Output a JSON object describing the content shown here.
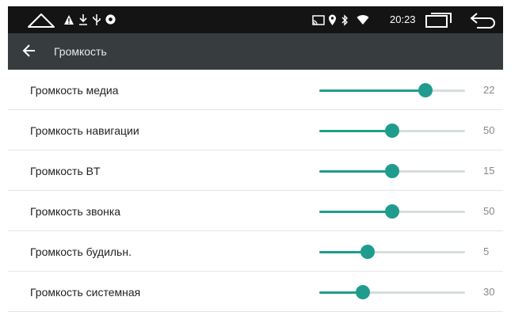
{
  "status_bar": {
    "time": "20:23",
    "icons": [
      "home-icon",
      "warning-icon",
      "download-icon",
      "usb-icon",
      "settings-icon",
      "cast-icon",
      "location-icon",
      "bluetooth-icon",
      "wifi-icon",
      "recents-icon",
      "back-nav-icon"
    ]
  },
  "toolbar": {
    "title": "Громкость",
    "back_icon": "arrow-left-icon"
  },
  "accent_color": "#1f9c8d",
  "items": [
    {
      "label": "Громкость медиа",
      "value": "22",
      "fraction": 0.73
    },
    {
      "label": "Громкость навигации",
      "value": "50",
      "fraction": 0.5
    },
    {
      "label": "Громкость BT",
      "value": "15",
      "fraction": 0.5
    },
    {
      "label": "Громкость звонка",
      "value": "50",
      "fraction": 0.5
    },
    {
      "label": "Громкость будильн.",
      "value": "5",
      "fraction": 0.33
    },
    {
      "label": "Громкость системная",
      "value": "30",
      "fraction": 0.3
    }
  ]
}
